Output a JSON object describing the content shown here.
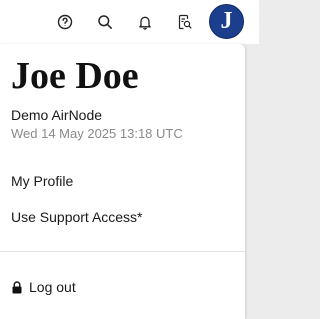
{
  "topbar": {
    "icons": [
      "help-icon",
      "search-icon",
      "bell-icon",
      "document-search-icon"
    ],
    "avatar_initial": "J",
    "avatar_color": "#1b3f8c"
  },
  "profile": {
    "name": "Joe Doe",
    "node": "Demo AirNode",
    "timestamp": "Wed 14 May 2025 13:18 UTC"
  },
  "menu": {
    "my_profile": "My Profile",
    "support_access": "Use Support Access*",
    "logout": "Log out",
    "logout_icon": "lock-icon"
  }
}
